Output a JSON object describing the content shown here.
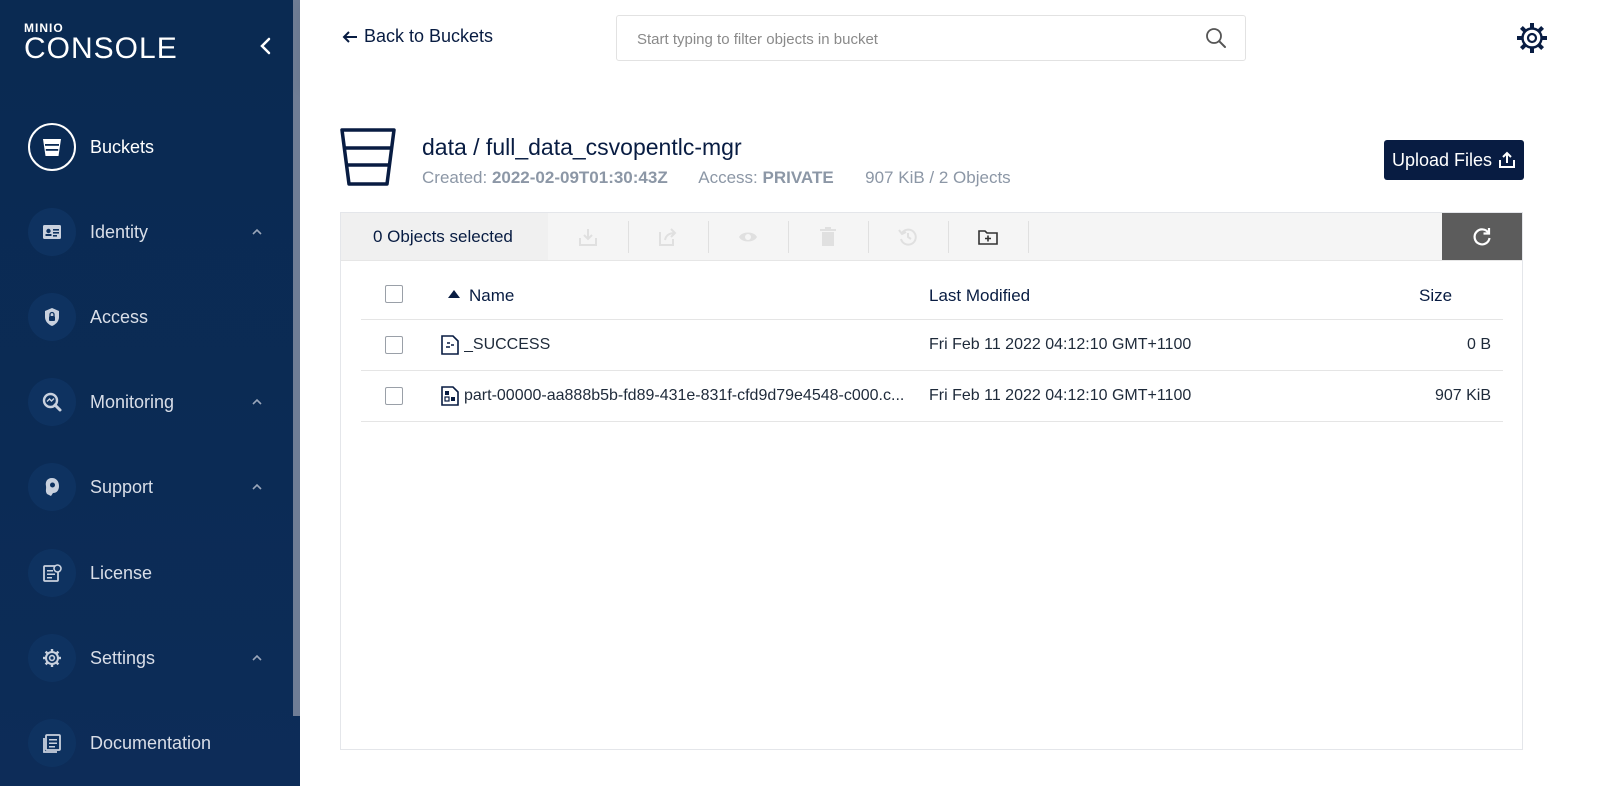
{
  "sidebar": {
    "logo_small": "MINIO",
    "logo_big": "CONSOLE",
    "items": [
      {
        "label": "Buckets",
        "icon": "bucket-icon",
        "active": true,
        "expandable": false
      },
      {
        "label": "Identity",
        "icon": "identity-card-icon",
        "active": false,
        "expandable": true
      },
      {
        "label": "Access",
        "icon": "lock-shield-icon",
        "active": false,
        "expandable": false
      },
      {
        "label": "Monitoring",
        "icon": "monitoring-magnifier-icon",
        "active": false,
        "expandable": true
      },
      {
        "label": "Support",
        "icon": "support-headset-icon",
        "active": false,
        "expandable": true
      },
      {
        "label": "License",
        "icon": "license-certificate-icon",
        "active": false,
        "expandable": false
      },
      {
        "label": "Settings",
        "icon": "gear-icon",
        "active": false,
        "expandable": true
      },
      {
        "label": "Documentation",
        "icon": "document-icon",
        "active": false,
        "expandable": false
      }
    ]
  },
  "header": {
    "back_label": "Back to Buckets",
    "search_placeholder": "Start typing to filter objects in bucket"
  },
  "bucket": {
    "title": "data / full_data_csvopentlc-mgr",
    "created_label": "Created:",
    "created_value": "2022-02-09T01:30:43Z",
    "access_label": "Access:",
    "access_value": "PRIVATE",
    "usage": "907 KiB / 2 Objects",
    "upload_label": "Upload Files"
  },
  "toolbar": {
    "selected_text": "0 Objects selected"
  },
  "table": {
    "columns": {
      "name": "Name",
      "modified": "Last Modified",
      "size": "Size"
    },
    "rows": [
      {
        "name": "_SUCCESS",
        "modified": "Fri Feb 11 2022 04:12:10 GMT+1100",
        "size": "0 B"
      },
      {
        "name": "part-00000-aa888b5b-fd89-431e-831f-cfd9d79e4548-c000.c...",
        "modified": "Fri Feb 11 2022 04:12:10 GMT+1100",
        "size": "907 KiB"
      }
    ]
  },
  "colors": {
    "sidebar": "#0b2b55",
    "primary": "#081c42",
    "muted": "#8c97a6",
    "refresh": "#5c5c5c"
  }
}
